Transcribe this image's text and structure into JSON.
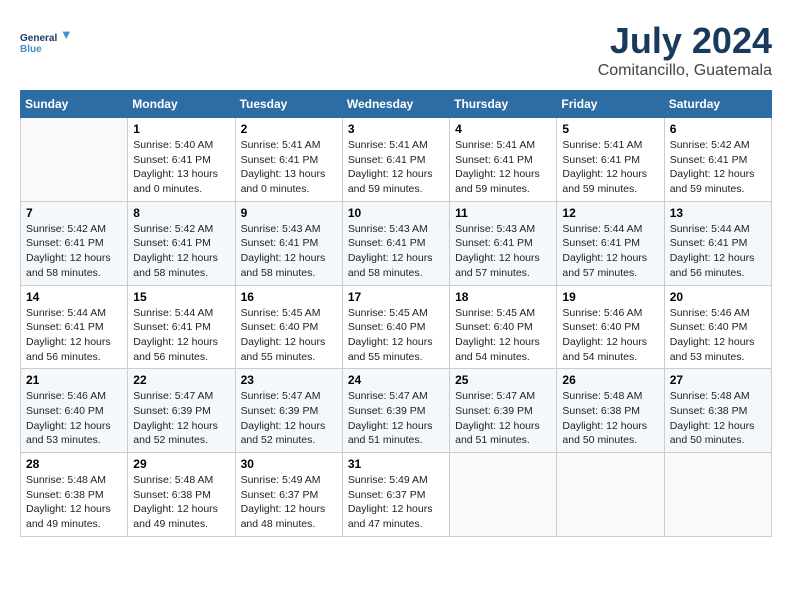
{
  "header": {
    "logo_line1": "General",
    "logo_line2": "Blue",
    "month": "July 2024",
    "location": "Comitancillo, Guatemala"
  },
  "days_of_week": [
    "Sunday",
    "Monday",
    "Tuesday",
    "Wednesday",
    "Thursday",
    "Friday",
    "Saturday"
  ],
  "weeks": [
    [
      {
        "day": "",
        "empty": true
      },
      {
        "day": "1",
        "sunrise": "5:40 AM",
        "sunset": "6:41 PM",
        "daylight": "13 hours and 0 minutes."
      },
      {
        "day": "2",
        "sunrise": "5:41 AM",
        "sunset": "6:41 PM",
        "daylight": "13 hours and 0 minutes."
      },
      {
        "day": "3",
        "sunrise": "5:41 AM",
        "sunset": "6:41 PM",
        "daylight": "12 hours and 59 minutes."
      },
      {
        "day": "4",
        "sunrise": "5:41 AM",
        "sunset": "6:41 PM",
        "daylight": "12 hours and 59 minutes."
      },
      {
        "day": "5",
        "sunrise": "5:41 AM",
        "sunset": "6:41 PM",
        "daylight": "12 hours and 59 minutes."
      },
      {
        "day": "6",
        "sunrise": "5:42 AM",
        "sunset": "6:41 PM",
        "daylight": "12 hours and 59 minutes."
      }
    ],
    [
      {
        "day": "7",
        "sunrise": "5:42 AM",
        "sunset": "6:41 PM",
        "daylight": "12 hours and 58 minutes."
      },
      {
        "day": "8",
        "sunrise": "5:42 AM",
        "sunset": "6:41 PM",
        "daylight": "12 hours and 58 minutes."
      },
      {
        "day": "9",
        "sunrise": "5:43 AM",
        "sunset": "6:41 PM",
        "daylight": "12 hours and 58 minutes."
      },
      {
        "day": "10",
        "sunrise": "5:43 AM",
        "sunset": "6:41 PM",
        "daylight": "12 hours and 58 minutes."
      },
      {
        "day": "11",
        "sunrise": "5:43 AM",
        "sunset": "6:41 PM",
        "daylight": "12 hours and 57 minutes."
      },
      {
        "day": "12",
        "sunrise": "5:44 AM",
        "sunset": "6:41 PM",
        "daylight": "12 hours and 57 minutes."
      },
      {
        "day": "13",
        "sunrise": "5:44 AM",
        "sunset": "6:41 PM",
        "daylight": "12 hours and 56 minutes."
      }
    ],
    [
      {
        "day": "14",
        "sunrise": "5:44 AM",
        "sunset": "6:41 PM",
        "daylight": "12 hours and 56 minutes."
      },
      {
        "day": "15",
        "sunrise": "5:44 AM",
        "sunset": "6:41 PM",
        "daylight": "12 hours and 56 minutes."
      },
      {
        "day": "16",
        "sunrise": "5:45 AM",
        "sunset": "6:40 PM",
        "daylight": "12 hours and 55 minutes."
      },
      {
        "day": "17",
        "sunrise": "5:45 AM",
        "sunset": "6:40 PM",
        "daylight": "12 hours and 55 minutes."
      },
      {
        "day": "18",
        "sunrise": "5:45 AM",
        "sunset": "6:40 PM",
        "daylight": "12 hours and 54 minutes."
      },
      {
        "day": "19",
        "sunrise": "5:46 AM",
        "sunset": "6:40 PM",
        "daylight": "12 hours and 54 minutes."
      },
      {
        "day": "20",
        "sunrise": "5:46 AM",
        "sunset": "6:40 PM",
        "daylight": "12 hours and 53 minutes."
      }
    ],
    [
      {
        "day": "21",
        "sunrise": "5:46 AM",
        "sunset": "6:40 PM",
        "daylight": "12 hours and 53 minutes."
      },
      {
        "day": "22",
        "sunrise": "5:47 AM",
        "sunset": "6:39 PM",
        "daylight": "12 hours and 52 minutes."
      },
      {
        "day": "23",
        "sunrise": "5:47 AM",
        "sunset": "6:39 PM",
        "daylight": "12 hours and 52 minutes."
      },
      {
        "day": "24",
        "sunrise": "5:47 AM",
        "sunset": "6:39 PM",
        "daylight": "12 hours and 51 minutes."
      },
      {
        "day": "25",
        "sunrise": "5:47 AM",
        "sunset": "6:39 PM",
        "daylight": "12 hours and 51 minutes."
      },
      {
        "day": "26",
        "sunrise": "5:48 AM",
        "sunset": "6:38 PM",
        "daylight": "12 hours and 50 minutes."
      },
      {
        "day": "27",
        "sunrise": "5:48 AM",
        "sunset": "6:38 PM",
        "daylight": "12 hours and 50 minutes."
      }
    ],
    [
      {
        "day": "28",
        "sunrise": "5:48 AM",
        "sunset": "6:38 PM",
        "daylight": "12 hours and 49 minutes."
      },
      {
        "day": "29",
        "sunrise": "5:48 AM",
        "sunset": "6:38 PM",
        "daylight": "12 hours and 49 minutes."
      },
      {
        "day": "30",
        "sunrise": "5:49 AM",
        "sunset": "6:37 PM",
        "daylight": "12 hours and 48 minutes."
      },
      {
        "day": "31",
        "sunrise": "5:49 AM",
        "sunset": "6:37 PM",
        "daylight": "12 hours and 47 minutes."
      },
      {
        "day": "",
        "empty": true
      },
      {
        "day": "",
        "empty": true
      },
      {
        "day": "",
        "empty": true
      }
    ]
  ]
}
